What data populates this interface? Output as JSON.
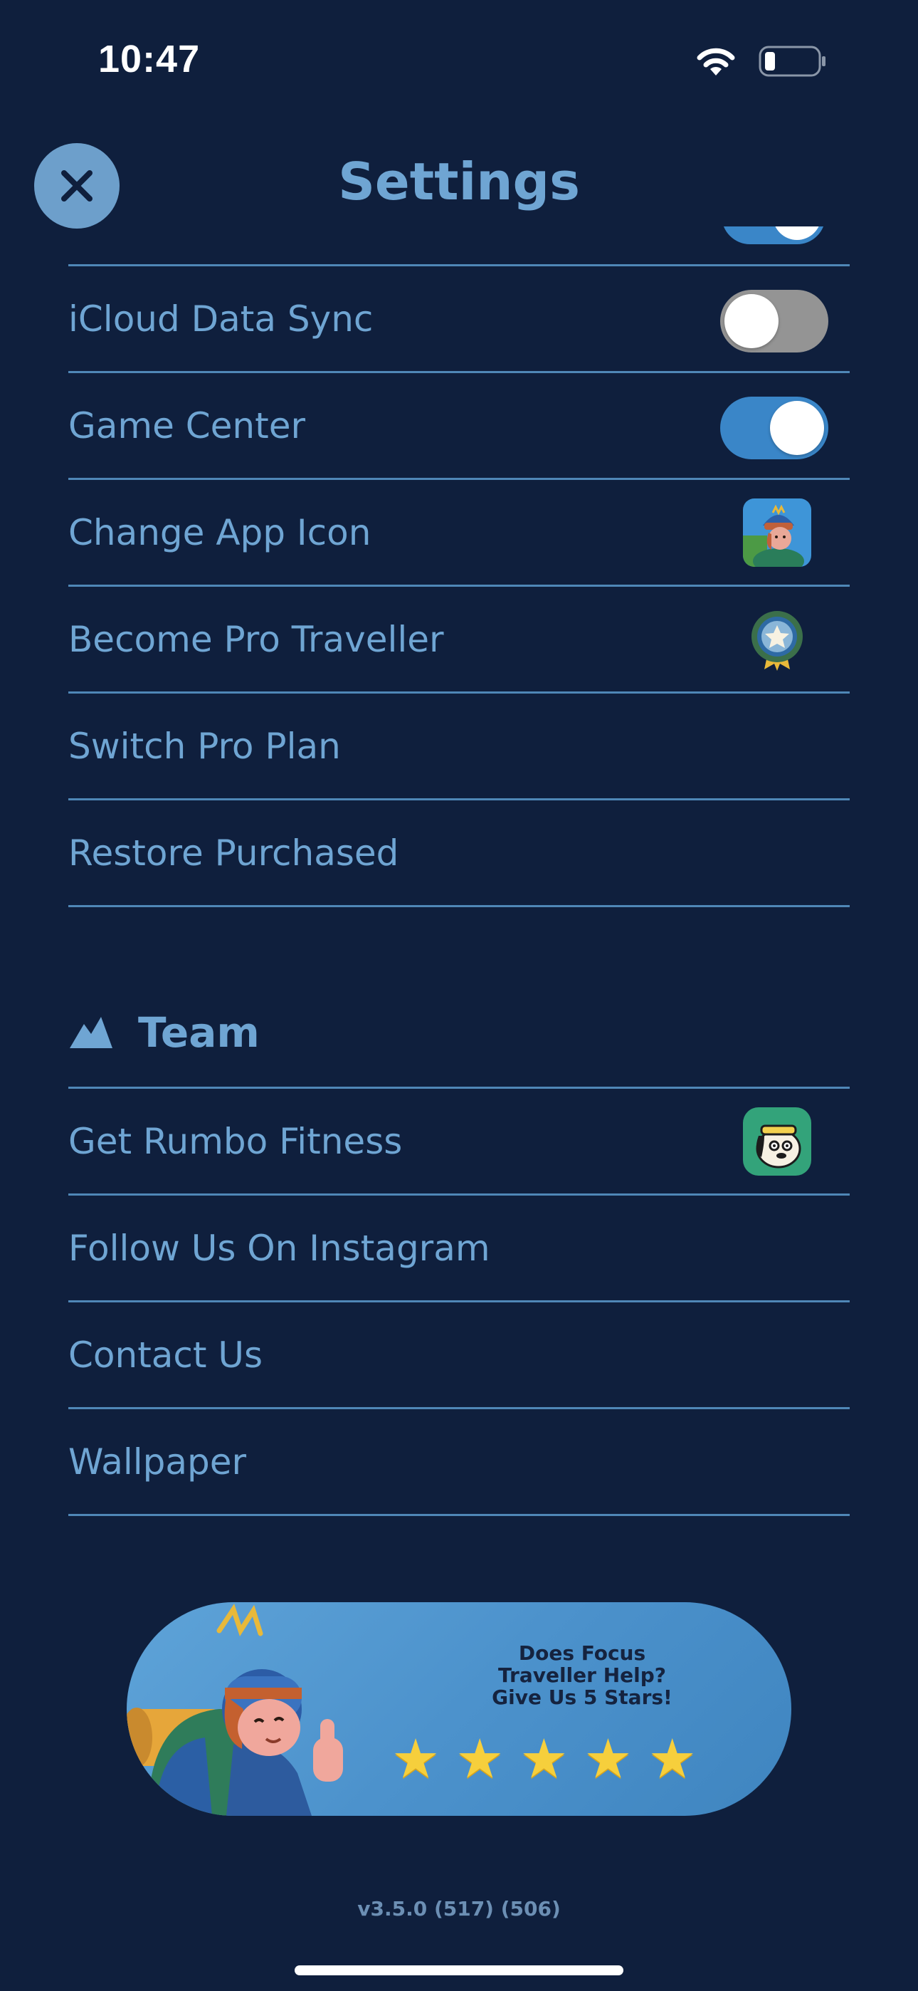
{
  "status_bar": {
    "time": "10:47"
  },
  "header": {
    "title": "Settings",
    "close_icon": "close-x-icon"
  },
  "settings": {
    "rows": [
      {
        "label": "iCloud Data Sync",
        "control": "toggle",
        "on": false
      },
      {
        "label": "Game Center",
        "control": "toggle",
        "on": true
      },
      {
        "label": "Change App Icon",
        "control": "image",
        "icon": "app-icon-thumbnail"
      },
      {
        "label": "Become Pro Traveller",
        "control": "image",
        "icon": "pro-badge-icon"
      },
      {
        "label": "Switch Pro Plan"
      },
      {
        "label": "Restore Purchased"
      }
    ]
  },
  "team": {
    "title": "Team",
    "icon": "mountain-icon",
    "rows": [
      {
        "label": "Get Rumbo Fitness",
        "icon": "rumbo-fitness-app-icon"
      },
      {
        "label": "Follow Us On Instagram"
      },
      {
        "label": "Contact Us"
      },
      {
        "label": "Wallpaper"
      }
    ]
  },
  "rating_banner": {
    "line1": "Does Focus",
    "line2": "Traveller Help?",
    "line3": "Give Us 5 Stars!",
    "stars": 5
  },
  "version": "v3.5.0 (517) (506)",
  "colors": {
    "background": "#0f1f3d",
    "text": "#6fa5d3",
    "divider": "#4f87b7",
    "toggle_on": "#3a86c8",
    "toggle_off": "#949494",
    "star": "#f6cf3c"
  }
}
